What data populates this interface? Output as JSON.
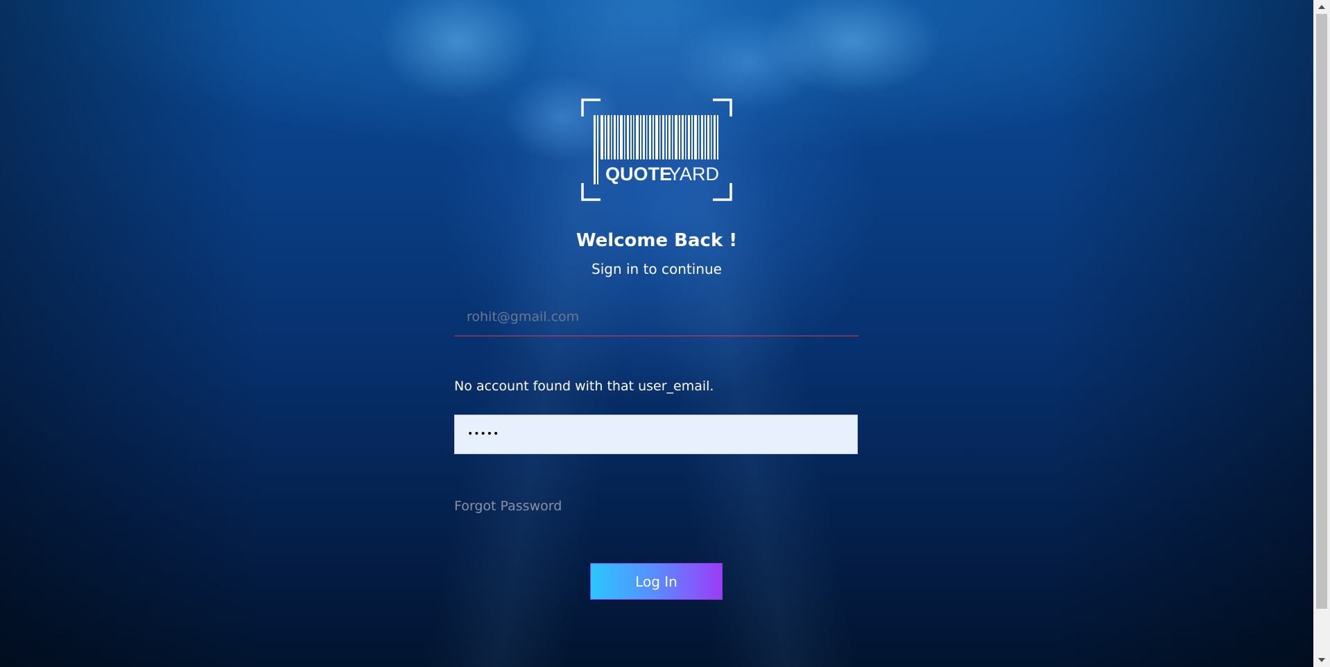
{
  "brand": {
    "logo_word_bold": "QUOTE",
    "logo_word_light": "YARD"
  },
  "login": {
    "title": "Welcome Back !",
    "subtitle": "Sign in to continue",
    "email_placeholder": "rohit@gmail.com",
    "email_value": "",
    "error_message": "No account found with that user_email.",
    "password_value": "•••••",
    "forgot_password_label": "Forgot Password",
    "login_button_label": "Log In"
  },
  "colors": {
    "background_top": "#0a4a93",
    "background_bottom": "#02142f",
    "error_underline": "#d9364f",
    "button_gradient_start": "#2bc6ff",
    "button_gradient_end": "#9b3cf6",
    "autofill_bg": "#e8f0fe"
  },
  "icons": {
    "scroll_up": "triangle-up-icon",
    "scroll_down": "triangle-down-icon"
  }
}
